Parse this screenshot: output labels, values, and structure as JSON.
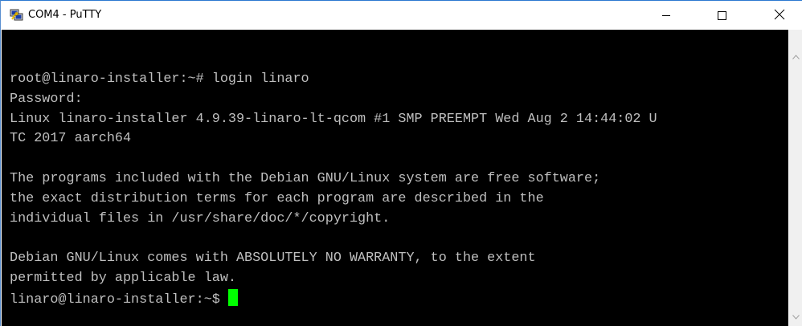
{
  "window": {
    "title": "COM4 - PuTTY",
    "app_icon": "putty-icon",
    "controls": {
      "minimize_icon": "minimize-icon",
      "maximize_icon": "maximize-icon",
      "close_icon": "close-icon"
    }
  },
  "terminal": {
    "background": "#000000",
    "foreground": "#bfbfbf",
    "cursor_color": "#00ff00",
    "lines": [
      "root@linaro-installer:~# login linaro",
      "Password:",
      "Linux linaro-installer 4.9.39-linaro-lt-qcom #1 SMP PREEMPT Wed Aug 2 14:44:02 U",
      "TC 2017 aarch64",
      "",
      "The programs included with the Debian GNU/Linux system are free software;",
      "the exact distribution terms for each program are described in the",
      "individual files in /usr/share/doc/*/copyright.",
      "",
      "Debian GNU/Linux comes with ABSOLUTELY NO WARRANTY, to the extent",
      "permitted by applicable law."
    ],
    "prompt": "linaro@linaro-installer:~$ "
  },
  "scrollbar": {
    "up_icon": "scroll-up-arrow-icon",
    "down_icon": "scroll-down-arrow-icon"
  }
}
